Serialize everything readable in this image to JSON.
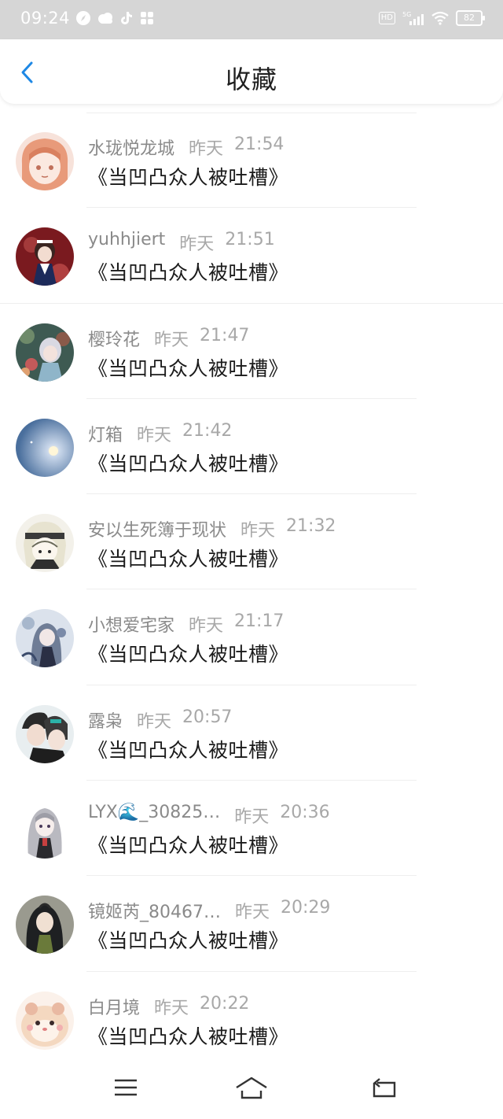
{
  "status_bar": {
    "time": "09:24",
    "battery": "82",
    "hd": "HD",
    "network": "5G"
  },
  "header": {
    "title": "收藏"
  },
  "colors": {
    "accent": "#1e88e5",
    "status_bar_bg": "#d6d6d6",
    "text_primary": "#1a1a1a",
    "text_secondary": "#8f8f8f"
  },
  "items": [
    {
      "name": "水珑悦龙城",
      "date": "昨天",
      "time": "21:54",
      "title": "《当凹凸众人被吐槽》",
      "avatar": "peach-anime-avatar"
    },
    {
      "name": "yuhhjiert",
      "date": "昨天",
      "time": "21:51",
      "title": "《当凹凸众人被吐槽》",
      "avatar": "maid-anime-avatar"
    },
    {
      "name": "樱玲花",
      "date": "昨天",
      "time": "21:47",
      "title": "《当凹凸众人被吐槽》",
      "avatar": "forest-girl-avatar"
    },
    {
      "name": "灯箱",
      "date": "昨天",
      "time": "21:42",
      "title": "《当凹凸众人被吐槽》",
      "avatar": "moon-sky-avatar"
    },
    {
      "name": "安以生死簿于现状",
      "date": "昨天",
      "time": "21:32",
      "title": "《当凹凸众人被吐槽》",
      "avatar": "sketch-character-avatar"
    },
    {
      "name": "小想爱宅家",
      "date": "昨天",
      "time": "21:17",
      "title": "《当凹凸众人被吐槽》",
      "avatar": "dark-girl-avatar"
    },
    {
      "name": "露枭",
      "date": "昨天",
      "time": "20:57",
      "title": "《当凹凸众人被吐槽》",
      "avatar": "couple-avatar"
    },
    {
      "name": "LYX🌊_30825…",
      "date": "昨天",
      "time": "20:36",
      "title": "《当凹凸众人被吐槽》",
      "avatar": "silver-hair-avatar"
    },
    {
      "name": "镜姬芮_80467…",
      "date": "昨天",
      "time": "20:29",
      "title": "《当凹凸众人被吐槽》",
      "avatar": "dark-hair-avatar"
    },
    {
      "name": "白月境",
      "date": "昨天",
      "time": "20:22",
      "title": "《当凹凸众人被吐槽》",
      "avatar": "hamster-avatar"
    }
  ],
  "nav": {
    "menu_icon": "menu-icon",
    "home_icon": "home-icon",
    "back_icon": "back-nav-icon"
  }
}
